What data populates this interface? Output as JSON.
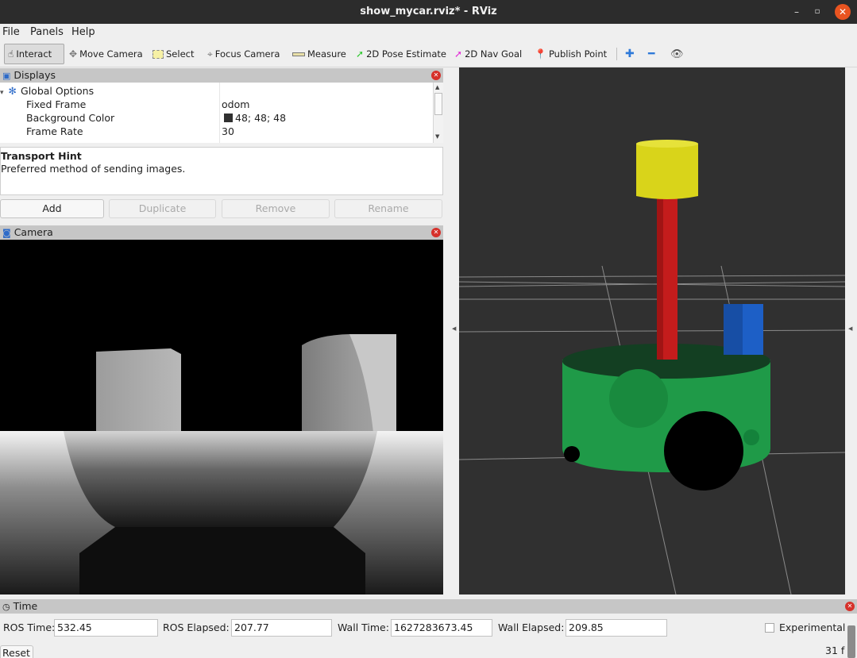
{
  "window": {
    "title": "show_mycar.rviz* - RViz",
    "minimize": "–",
    "maximize": "▫",
    "close": "✕"
  },
  "menu": {
    "file": "File",
    "panels": "Panels",
    "help": "Help"
  },
  "toolbar": {
    "interact": "Interact",
    "move_camera": "Move Camera",
    "select": "Select",
    "focus_camera": "Focus Camera",
    "measure": "Measure",
    "pose_estimate": "2D Pose Estimate",
    "nav_goal": "2D Nav Goal",
    "publish_point": "Publish Point"
  },
  "displays": {
    "title": "Displays",
    "rows": [
      {
        "name": "Global Options",
        "value": ""
      },
      {
        "name": "Fixed Frame",
        "value": "odom"
      },
      {
        "name": "Background Color",
        "value": "48; 48; 48"
      },
      {
        "name": "Frame Rate",
        "value": "30"
      }
    ],
    "hint_title": "Transport Hint",
    "hint_text": "Preferred method of sending images.",
    "buttons": {
      "add": "Add",
      "duplicate": "Duplicate",
      "remove": "Remove",
      "rename": "Rename"
    }
  },
  "camera": {
    "title": "Camera"
  },
  "time": {
    "title": "Time",
    "ros_time_label": "ROS Time:",
    "ros_time": "532.45",
    "ros_elapsed_label": "ROS Elapsed:",
    "ros_elapsed": "207.77",
    "wall_time_label": "Wall Time:",
    "wall_time": "1627283673.45",
    "wall_elapsed_label": "Wall Elapsed:",
    "wall_elapsed": "209.85",
    "experimental": "Experimental",
    "reset": "Reset",
    "fps": "31 f"
  },
  "colors": {
    "background": "#303030",
    "accent_close": "#e95420",
    "panel_header": "#c6c6c6"
  }
}
